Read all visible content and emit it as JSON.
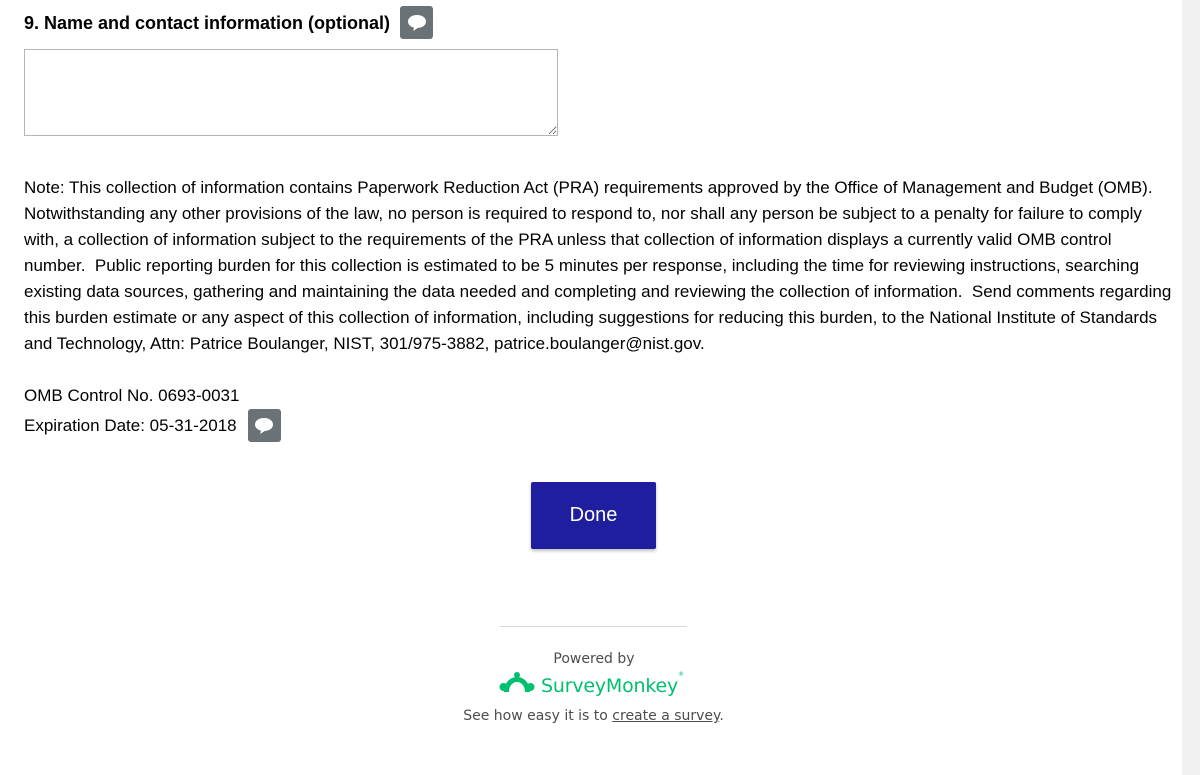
{
  "question": {
    "number": "9.",
    "title": "Name and contact information (optional)",
    "answer_value": "",
    "comment_icon": "comment-bubble-icon"
  },
  "note": {
    "text": "Note: This collection of information contains Paperwork Reduction Act (PRA) requirements approved by the Office of Management and Budget (OMB).  Notwithstanding any other provisions of the law, no person is required to respond to, nor shall any person be subject to a penalty for failure to comply with, a collection of information subject to the requirements of the PRA unless that collection of information displays a currently valid OMB control number.  Public reporting burden for this collection is estimated to be 5 minutes per response, including the time for reviewing instructions, searching existing data sources, gathering and maintaining the data needed and completing and reviewing the collection of information.  Send comments regarding this burden estimate or any aspect of this collection of information, including suggestions for reducing this burden, to the National Institute of Standards and Technology, Attn: Patrice Boulanger, NIST, 301/975-3882, patrice.boulanger@nist.gov."
  },
  "omb": {
    "control_no": "OMB Control No. 0693-0031",
    "expiration": "Expiration Date: 05-31-2018",
    "comment_icon": "comment-bubble-icon"
  },
  "done_button": {
    "label": "Done"
  },
  "footer": {
    "powered_by": "Powered by",
    "brand_name": "SurveyMonkey",
    "brand_icon": "surveymonkey-logo-icon",
    "create_prefix": "See how easy it is to ",
    "create_link": "create a survey",
    "create_suffix": "."
  },
  "colors": {
    "button_bg": "#1f1e9f",
    "comment_icon_bg": "#6b7277",
    "brand_green": "#00bf6f"
  }
}
